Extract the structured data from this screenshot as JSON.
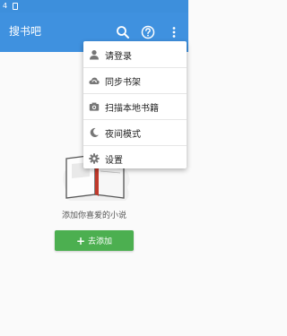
{
  "status_bar": {
    "time": "4"
  },
  "app_bar": {
    "title": "搜书吧",
    "actions": [
      "search-icon",
      "help-icon",
      "more-vert-icon"
    ]
  },
  "menu": {
    "items": [
      {
        "label": "请登录",
        "icon": "person-icon"
      },
      {
        "label": "同步书架",
        "icon": "cloud-sync-icon"
      },
      {
        "label": "扫描本地书籍",
        "icon": "camera-icon"
      },
      {
        "label": "夜间模式",
        "icon": "moon-icon"
      },
      {
        "label": "设置",
        "icon": "gear-icon"
      }
    ]
  },
  "empty_state": {
    "message": "添加你喜爱的小说",
    "add_button_label": "去添加"
  },
  "colors": {
    "app_bar": "#3f91df",
    "status_bar": "#3d8fdc",
    "add_button": "#4caf50",
    "background": "#fafafa"
  }
}
